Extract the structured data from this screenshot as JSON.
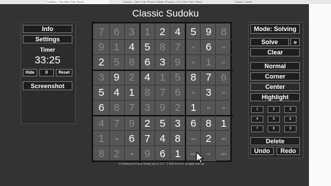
{
  "browser": {
    "tabs": [
      {
        "label": "Sudoku - The New York Times"
      },
      {
        "label": "Sudoku - New York Times Sudoku Puzzles | The New York Times"
      },
      {
        "label": "Sudoku Jones"
      }
    ]
  },
  "app": {
    "title": "Classic Sudoku",
    "footer": "© Puzzles.com Puzzle Setting Tool v1.11.2 · © 2020 Erlo Fox. All rights reserved."
  },
  "left_panel": {
    "info_label": "Info",
    "settings_label": "Settings",
    "timer_heading": "Timer",
    "timer_value": "33:25",
    "hide_label": "Hide",
    "pause_label": "II",
    "reset_label": "Reset",
    "screenshot_label": "Screenshot"
  },
  "right_panel": {
    "mode_label": "Mode: Solving",
    "solve_label": "Solve",
    "solve_more_label": "»",
    "clear_label": "Clear",
    "normal_label": "Normal",
    "corner_label": "Corner",
    "center_label": "Center",
    "highlight_label": "Highlight",
    "delete_label": "Delete",
    "undo_label": "Undo",
    "redo_label": "Redo",
    "numpad": [
      "1",
      "2",
      "3",
      "4",
      "5",
      "6",
      "7",
      "8",
      "9"
    ]
  },
  "grid": {
    "rows": [
      [
        {
          "v": "7",
          "t": "g"
        },
        {
          "v": "6",
          "t": "g"
        },
        {
          "v": "3",
          "t": "g"
        },
        {
          "v": "1",
          "t": "g"
        },
        {
          "v": "2",
          "t": "b"
        },
        {
          "v": "4",
          "t": "b"
        },
        {
          "v": "5",
          "t": "b"
        },
        {
          "v": "9",
          "t": "b"
        },
        {
          "v": "8",
          "t": "g"
        }
      ],
      [
        {
          "v": "9",
          "t": "g"
        },
        {
          "v": "1",
          "t": "g"
        },
        {
          "v": "4",
          "t": "b"
        },
        {
          "v": "5",
          "t": "b"
        },
        {
          "v": "8",
          "t": "g"
        },
        {
          "v": "7",
          "t": "g"
        },
        {
          "v": "23",
          "t": "p"
        },
        {
          "v": "6",
          "t": "b"
        },
        {
          "v": "23",
          "t": "p"
        }
      ],
      [
        {
          "v": "2",
          "t": "b"
        },
        {
          "v": "5",
          "t": "g"
        },
        {
          "v": "8",
          "t": "g"
        },
        {
          "v": "6",
          "t": "b"
        },
        {
          "v": "3",
          "t": "b"
        },
        {
          "v": "9",
          "t": "g"
        },
        {
          "v": "47",
          "t": "p"
        },
        {
          "v": "1",
          "t": "g"
        },
        {
          "v": "47",
          "t": "p"
        }
      ],
      [
        {
          "v": "3",
          "t": "g"
        },
        {
          "v": "9",
          "t": "b"
        },
        {
          "v": "2",
          "t": "g"
        },
        {
          "v": "4",
          "t": "b"
        },
        {
          "v": "1",
          "t": "g"
        },
        {
          "v": "5",
          "t": "g"
        },
        {
          "v": "8",
          "t": "b"
        },
        {
          "v": "7",
          "t": "b"
        },
        {
          "v": "6",
          "t": "g"
        }
      ],
      [
        {
          "v": "5",
          "t": "b"
        },
        {
          "v": "4",
          "t": "b"
        },
        {
          "v": "1",
          "t": "b"
        },
        {
          "v": "8",
          "t": "g"
        },
        {
          "v": "7",
          "t": "g"
        },
        {
          "v": "6",
          "t": "g"
        },
        {
          "v": "29",
          "t": "p"
        },
        {
          "v": "3",
          "t": "b"
        },
        {
          "v": "29",
          "t": "p"
        }
      ],
      [
        {
          "v": "6",
          "t": "b"
        },
        {
          "v": "8",
          "t": "g"
        },
        {
          "v": "7",
          "t": "g"
        },
        {
          "v": "3",
          "t": "g"
        },
        {
          "v": "9",
          "t": "g"
        },
        {
          "v": "2",
          "t": "g"
        },
        {
          "v": "1",
          "t": "b"
        },
        {
          "v": "45",
          "t": "p"
        },
        {
          "v": "45",
          "t": "p"
        }
      ],
      [
        {
          "v": "4",
          "t": "g"
        },
        {
          "v": "7",
          "t": "g"
        },
        {
          "v": "9",
          "t": "g"
        },
        {
          "v": "2",
          "t": "b"
        },
        {
          "v": "5",
          "t": "b"
        },
        {
          "v": "3",
          "t": "b"
        },
        {
          "v": "6",
          "t": "b"
        },
        {
          "v": "8",
          "t": "b"
        },
        {
          "v": "1",
          "t": "b"
        }
      ],
      [
        {
          "v": "1",
          "t": "g"
        },
        {
          "v": "35",
          "t": "p"
        },
        {
          "v": "6",
          "t": "b"
        },
        {
          "v": "7",
          "t": "b"
        },
        {
          "v": "4",
          "t": "b"
        },
        {
          "v": "8",
          "t": "b"
        },
        {
          "v": "309",
          "t": "p"
        },
        {
          "v": "2",
          "t": "b"
        },
        {
          "v": "359",
          "t": "p"
        }
      ],
      [
        {
          "v": "8",
          "t": "g"
        },
        {
          "v": "2",
          "t": "g"
        },
        {
          "v": "35",
          "t": "p"
        },
        {
          "v": "9",
          "t": "g"
        },
        {
          "v": "6",
          "t": "b"
        },
        {
          "v": "1",
          "t": "b"
        },
        {
          "v": "3457",
          "t": "p"
        },
        {
          "v": "45",
          "t": "p"
        },
        {
          "v": "3457",
          "t": "p"
        }
      ]
    ]
  }
}
